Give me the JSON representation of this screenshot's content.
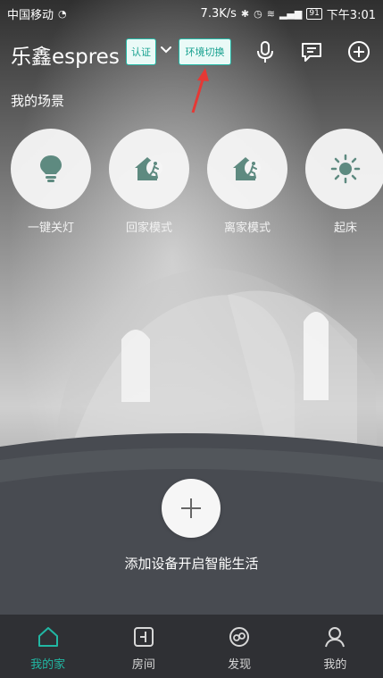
{
  "status_bar": {
    "carrier": "中国移动",
    "speed": "7.3K/s",
    "battery": "91",
    "time": "下午3:01"
  },
  "header": {
    "home_name": "乐鑫espres",
    "verify_badge": "认证",
    "switch_badge": "环境切换",
    "icons": [
      "microphone-icon",
      "message-icon",
      "plus-circle-icon"
    ]
  },
  "scenes": {
    "title": "我的场景",
    "items": [
      {
        "label": "一键关灯",
        "icon": "bulb-icon"
      },
      {
        "label": "回家模式",
        "icon": "home-person-icon"
      },
      {
        "label": "离家模式",
        "icon": "home-person-icon"
      },
      {
        "label": "起床",
        "icon": "sun-icon"
      }
    ]
  },
  "main": {
    "add_device_label": "添加设备开启智能生活"
  },
  "bottom_nav": {
    "items": [
      {
        "label": "我的家",
        "icon": "home-icon",
        "active": true
      },
      {
        "label": "房间",
        "icon": "room-icon",
        "active": false
      },
      {
        "label": "发现",
        "icon": "discover-icon",
        "active": false
      },
      {
        "label": "我的",
        "icon": "user-icon",
        "active": false
      }
    ]
  },
  "colors": {
    "accent": "#21b7a3",
    "scene_icon": "#5e8a80",
    "nav_bg": "#2f3034",
    "arrow": "#e53935"
  }
}
